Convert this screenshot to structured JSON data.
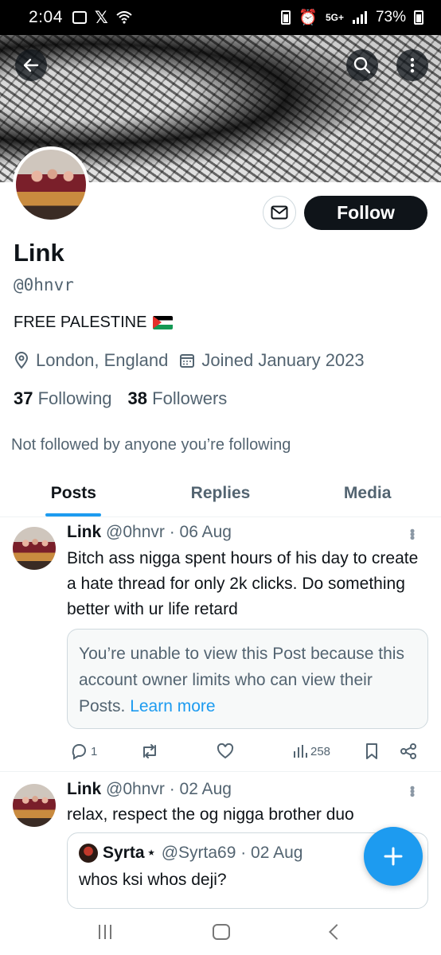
{
  "status_bar": {
    "time": "2:04",
    "battery": "73%",
    "network": "5G+"
  },
  "profile": {
    "name": "Link",
    "handle": "@0hnvr",
    "bio": "FREE PALESTINE",
    "location": "London, England",
    "joined": "Joined January 2023",
    "following_count": "37",
    "following_label": "Following",
    "followers_count": "38",
    "followers_label": "Followers",
    "not_followed_text": "Not followed by anyone you’re following",
    "follow_button": "Follow"
  },
  "tabs": [
    {
      "label": "Posts",
      "active": true
    },
    {
      "label": "Replies",
      "active": false
    },
    {
      "label": "Media",
      "active": false
    }
  ],
  "posts": [
    {
      "name": "Link",
      "meta": "@0hnvr · 06 Aug",
      "text": "Bitch ass nigga spent hours of his day to create a hate thread for only 2k clicks. Do something better with ur life retard",
      "limited_text": "You’re unable to view this Post because this account owner limits who can view their Posts.",
      "learn_more": "Learn more",
      "replies": "1",
      "views": "258"
    },
    {
      "name": "Link",
      "meta": "@0hnvr · 02 Aug",
      "text": "relax, respect the og nigga brother duo",
      "quote": {
        "name": "Syrta",
        "badge": "⋆",
        "meta": "@Syrta69 · 02 Aug",
        "text": "whos ksi whos deji?"
      }
    }
  ],
  "colors": {
    "accent": "#1d9bf0",
    "text": "#0f1419",
    "secondary": "#536471"
  }
}
